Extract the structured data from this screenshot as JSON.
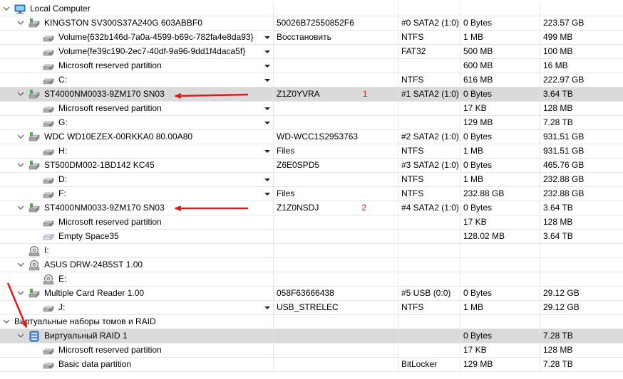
{
  "tree": {
    "rows": [
      {
        "level": 0,
        "expand": true,
        "icon": "computer-icon",
        "name": "Local Computer"
      },
      {
        "level": 1,
        "expand": true,
        "icon": "hard-drive-icon",
        "name": "KINGSTON SV300S37A240G 603ABBF0",
        "c1": "50026B72550852F6",
        "c2": "#0 SATA2 (1:0)",
        "c3": "0 Bytes",
        "c4": "223.57 GB"
      },
      {
        "level": 2,
        "icon": "partition-icon",
        "name": "Volume{632b146d-7a0a-4599-b69c-782fa4e8da93}",
        "dd": true,
        "c1": "Восстановить",
        "c2": "NTFS",
        "c3": "1 MB",
        "c4": "499 MB"
      },
      {
        "level": 2,
        "icon": "partition-icon",
        "name": "Volume{fe39c190-2ec7-40df-9a96-9dd1f4daca5f}",
        "dd": true,
        "c2": "FAT32",
        "c3": "500 MB",
        "c4": "100 MB"
      },
      {
        "level": 2,
        "icon": "partition-icon",
        "name": "Microsoft reserved partition",
        "dd": true,
        "c3": "600 MB",
        "c4": "16 MB"
      },
      {
        "level": 2,
        "icon": "partition-icon",
        "name": "C:",
        "dd": true,
        "c2": "NTFS",
        "c3": "616 MB",
        "c4": "222.97 GB"
      },
      {
        "level": 1,
        "expand": true,
        "icon": "hard-drive-icon",
        "name": "ST4000NM0033-9ZM170 SN03",
        "selected": true,
        "arrow": true,
        "c1": "Z1Z0YVRA",
        "mark": "1",
        "c2": "#1 SATA2 (1:0)",
        "c3": "0 Bytes",
        "c4": "3.64 TB"
      },
      {
        "level": 2,
        "icon": "partition-icon",
        "name": "Microsoft reserved partition",
        "dd": true,
        "c3": "17 KB",
        "c4": "128 MB"
      },
      {
        "level": 2,
        "icon": "partition-icon",
        "name": "G:",
        "dd": true,
        "c3": "129 MB",
        "c4": "7.28 TB"
      },
      {
        "level": 1,
        "expand": true,
        "icon": "hard-drive-icon",
        "name": "WDC WD10EZEX-00RKKA0 80.00A80",
        "c1": "WD-WCC1S2953763",
        "c2": "#2 SATA2 (1:0)",
        "c3": "0 Bytes",
        "c4": "931.51 GB"
      },
      {
        "level": 2,
        "icon": "partition-icon",
        "name": "H:",
        "dd": true,
        "c1": "Files",
        "c2": "NTFS",
        "c3": "1 MB",
        "c4": "931.51 GB"
      },
      {
        "level": 1,
        "expand": true,
        "icon": "hard-drive-icon",
        "name": "ST500DM002-1BD142 KC45",
        "c1": "Z6E0SPD5",
        "c2": "#3 SATA2 (1:0)",
        "c3": "0 Bytes",
        "c4": "465.76 GB"
      },
      {
        "level": 2,
        "icon": "partition-icon",
        "name": "D:",
        "dd": true,
        "c2": "NTFS",
        "c3": "1 MB",
        "c4": "232.88 GB"
      },
      {
        "level": 2,
        "icon": "partition-icon",
        "name": "F:",
        "dd": true,
        "c1": "Files",
        "c2": "NTFS",
        "c3": "232.88 GB",
        "c4": "232.88 GB"
      },
      {
        "level": 1,
        "expand": true,
        "icon": "hard-drive-icon",
        "name": "ST4000NM0033-9ZM170 SN03",
        "arrow": true,
        "c1": "Z1Z0NSDJ",
        "mark": "2",
        "c2": "#4 SATA2 (1:0)",
        "c3": "0 Bytes",
        "c4": "3.64 TB"
      },
      {
        "level": 2,
        "icon": "partition-icon",
        "name": "Microsoft reserved partition",
        "c3": "17 KB",
        "c4": "128 MB"
      },
      {
        "level": 2,
        "icon": "empty-space-icon",
        "name": "Empty Space35",
        "c3": "128.02 MB",
        "c4": "3.64 TB"
      },
      {
        "level": 1,
        "icon": "optical-drive-icon",
        "name": "I:"
      },
      {
        "level": 1,
        "expand": true,
        "icon": "optical-drive-icon",
        "name": "ASUS DRW-24B5ST 1.00"
      },
      {
        "level": 2,
        "icon": "optical-drive-icon",
        "name": "E:"
      },
      {
        "level": 1,
        "expand": true,
        "icon": "card-reader-icon",
        "name": "Multiple Card Reader 1.00",
        "c1": "058F63666438",
        "c2": "#5 USB (0:0)",
        "c3": "0 Bytes",
        "c4": "29.12 GB"
      },
      {
        "level": 2,
        "icon": "partition-icon",
        "name": "J:",
        "dd": true,
        "c1": "USB_STRELEC",
        "c2": "NTFS",
        "c3": "1 MB",
        "c4": "29.12 GB"
      },
      {
        "level": 0,
        "expand": true,
        "name": "Виртуальные наборы томов и RAID"
      },
      {
        "level": 1,
        "expand": true,
        "icon": "raid-icon",
        "name": "Виртуальный RAID 1",
        "selected": true,
        "c3": "0 Bytes",
        "c4": "7.28 TB"
      },
      {
        "level": 2,
        "icon": "partition-icon",
        "name": "Microsoft reserved partition",
        "c3": "17 KB",
        "c4": "128 MB"
      },
      {
        "level": 2,
        "icon": "partition-icon",
        "name": "Basic data partition",
        "c2": "BitLocker",
        "c3": "129 MB",
        "c4": "7.28 TB"
      }
    ]
  },
  "colors": {
    "arrow": "#e01818",
    "mark": "#d62020",
    "selected": "#dadada",
    "grid": "#e6e6e6"
  }
}
